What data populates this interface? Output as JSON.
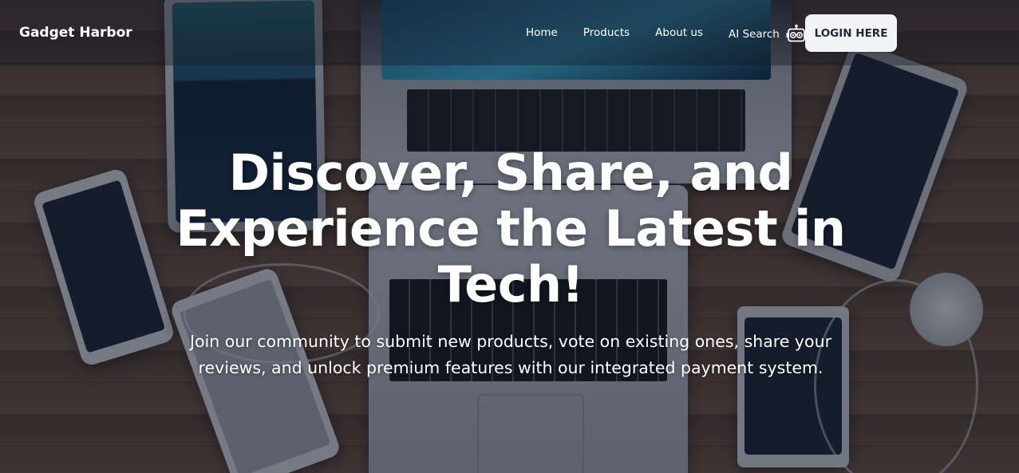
{
  "brand": {
    "name": "Gadget Harbor"
  },
  "nav": {
    "links": [
      {
        "label": "Home"
      },
      {
        "label": "Products"
      },
      {
        "label": "About us"
      },
      {
        "label": "AI Search",
        "icon": "robot-icon"
      }
    ],
    "login_label": "LOGIN HERE"
  },
  "hero": {
    "headline": "Discover, Share, and Experience the Latest in Tech!",
    "subtext": "Join our community to submit new products, vote on existing ones, share your reviews, and unlock premium features with our integrated payment system."
  },
  "colors": {
    "overlay": "#101626",
    "button_bg": "#f3f4f6",
    "button_text": "#1f2937",
    "text": "#ffffff"
  }
}
